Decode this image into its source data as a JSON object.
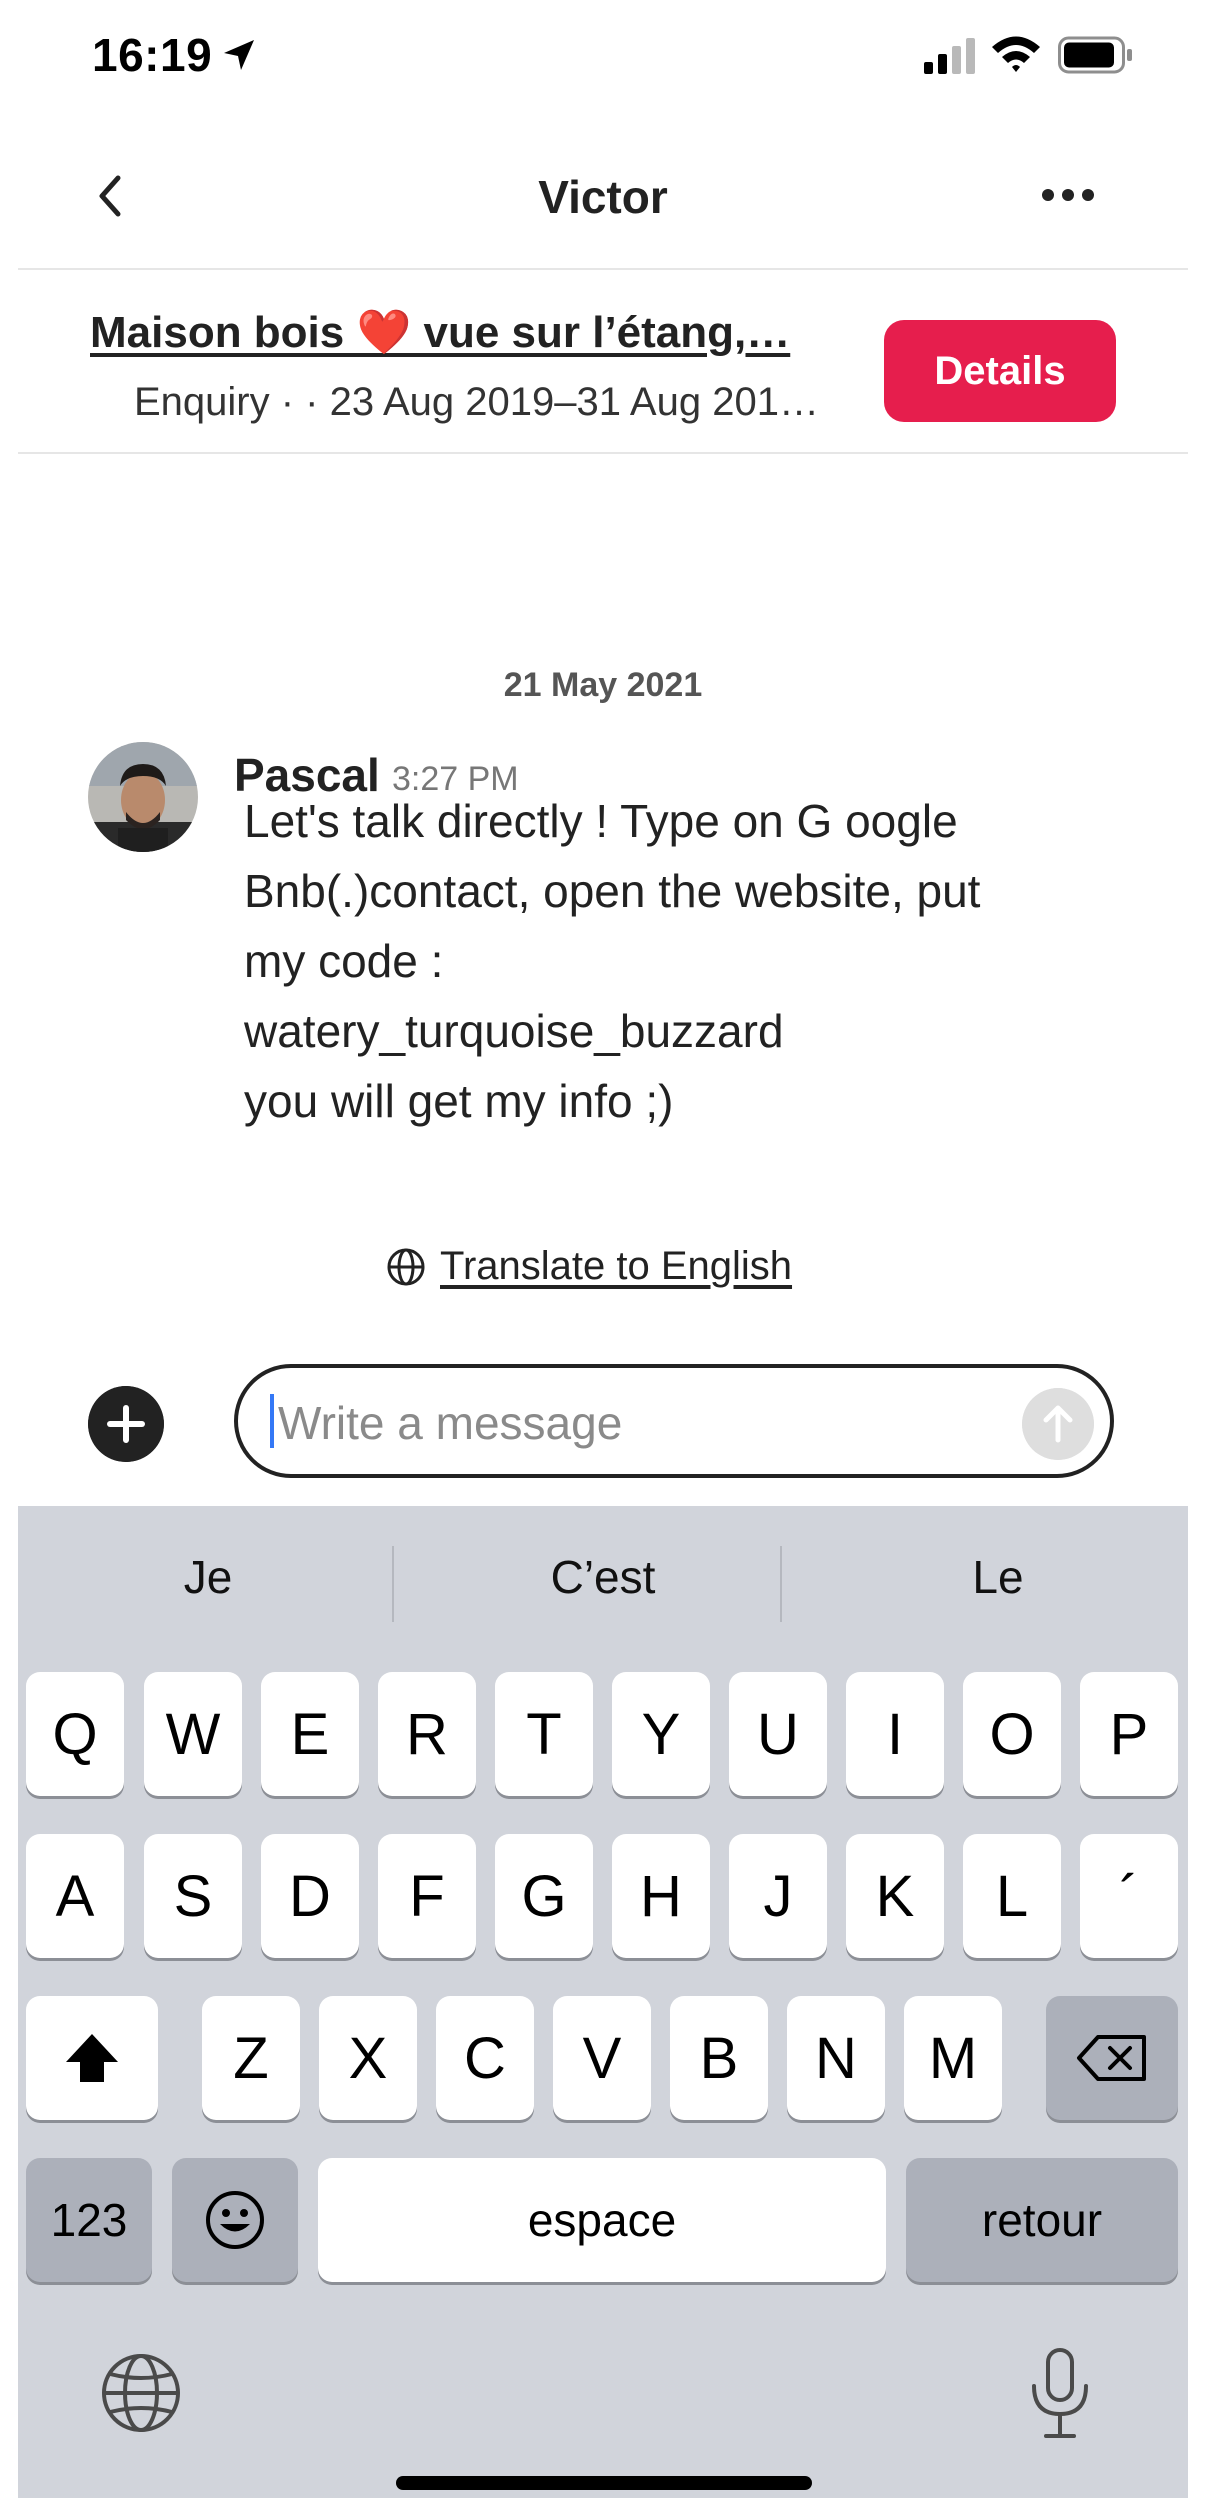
{
  "status_bar": {
    "time": "16:19"
  },
  "header": {
    "title": "Victor"
  },
  "listing": {
    "title": "Maison bois ❤️ vue sur l’étang,…",
    "subtitle": "Enquiry · · 23 Aug 2019–31 Aug 2019…",
    "details_label": "Details"
  },
  "messages": {
    "date": "21 May 2021",
    "items": [
      {
        "sender": "Pascal",
        "time": "3:27 PM",
        "lines": [
          "Let's talk directly ! Type on G oogle",
          "Bnb(.)contact, open the website, put",
          "my code :",
          "watery_turquoise_buzzard",
          " you will get my info ;)"
        ]
      }
    ],
    "translate_label": "Translate to English"
  },
  "composer": {
    "placeholder": "Write a message"
  },
  "keyboard": {
    "suggestions": [
      "Je",
      "C’est",
      "Le"
    ],
    "row1": [
      "Q",
      "W",
      "E",
      "R",
      "T",
      "Y",
      "U",
      "I",
      "O",
      "P"
    ],
    "row2": [
      "A",
      "S",
      "D",
      "F",
      "G",
      "H",
      "J",
      "K",
      "L",
      "´"
    ],
    "row3": [
      "Z",
      "X",
      "C",
      "V",
      "B",
      "N",
      "M"
    ],
    "numbers_label": "123",
    "space_label": "espace",
    "return_label": "retour"
  },
  "colors": {
    "accent": "#e61e4d",
    "text": "#222222",
    "keyboard_bg": "#d1d4db",
    "cursor": "#3478f6"
  },
  "icons": {
    "back": "chevron-left-icon",
    "more": "ellipsis-icon",
    "translate": "globe-icon",
    "add": "plus-circle-icon",
    "send": "arrow-up-icon",
    "shift": "shift-icon",
    "delete": "backspace-icon",
    "emoji": "emoji-icon",
    "globe": "globe-icon",
    "mic": "microphone-icon"
  }
}
